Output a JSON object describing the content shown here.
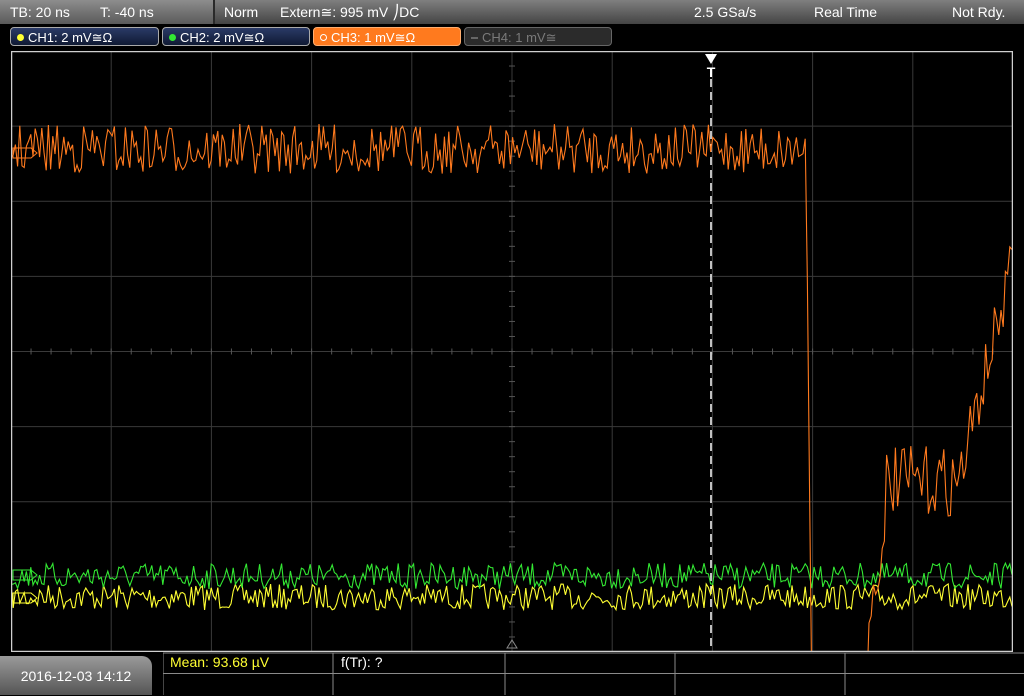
{
  "status": {
    "timebase": "TB: 20 ns",
    "trigger_time": "T: -40 ns",
    "mode": "Norm",
    "trigger_source": "Extern≅: 995 mV ⎠DC",
    "sample_rate": "2.5 GSa/s",
    "acq_mode": "Real Time",
    "state": "Not Rdy."
  },
  "channels": [
    {
      "label": "CH1: 2 mV≅Ω",
      "color": "#ffff33"
    },
    {
      "label": "CH2: 2 mV≅Ω",
      "color": "#33e833"
    },
    {
      "label": "CH3: 1 mV≅Ω",
      "color": "#ff7a1e"
    },
    {
      "label": "CH4: 1 mV≅",
      "color": "#888888"
    }
  ],
  "trigger_marker": "T",
  "datetime": "2016-12-03 14:12",
  "measurements": {
    "mean": "Mean: 93.68 µV",
    "ftr": "f(Tr): ?"
  },
  "colors": {
    "grid": "#3a3a3a",
    "frame": "#cfcfcf",
    "ch1": "#ffff33",
    "ch2": "#33e833",
    "ch3": "#ff7a1e",
    "meas_text": "#ffff33"
  }
}
